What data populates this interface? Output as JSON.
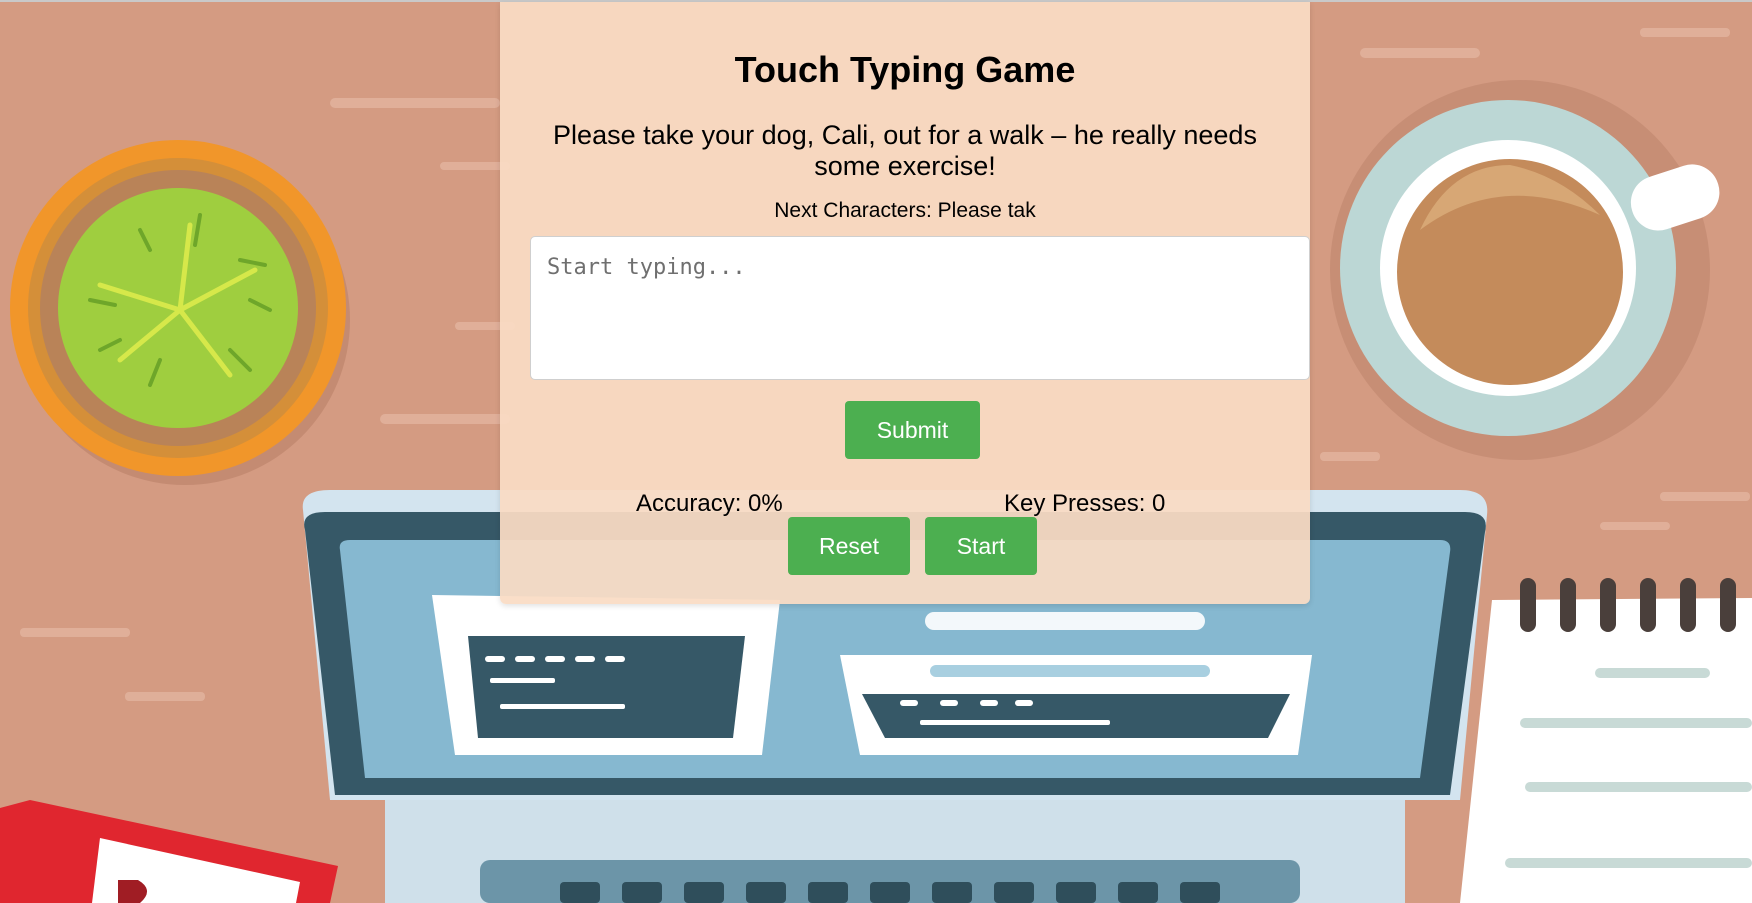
{
  "game": {
    "title": "Touch Typing Game",
    "sentence": "Please take your dog, Cali, out for a walk – he really needs some exercise!",
    "next_chars": "Next Characters: Please tak",
    "input_placeholder": "Start typing...",
    "submit_label": "Submit",
    "accuracy_text": "Accuracy: 0%",
    "key_presses_text": "Key Presses: 0",
    "reset_label": "Reset",
    "start_label": "Start"
  },
  "colors": {
    "accent": "#4caf50",
    "background": "#d49b82",
    "card": "#fadcc4"
  }
}
